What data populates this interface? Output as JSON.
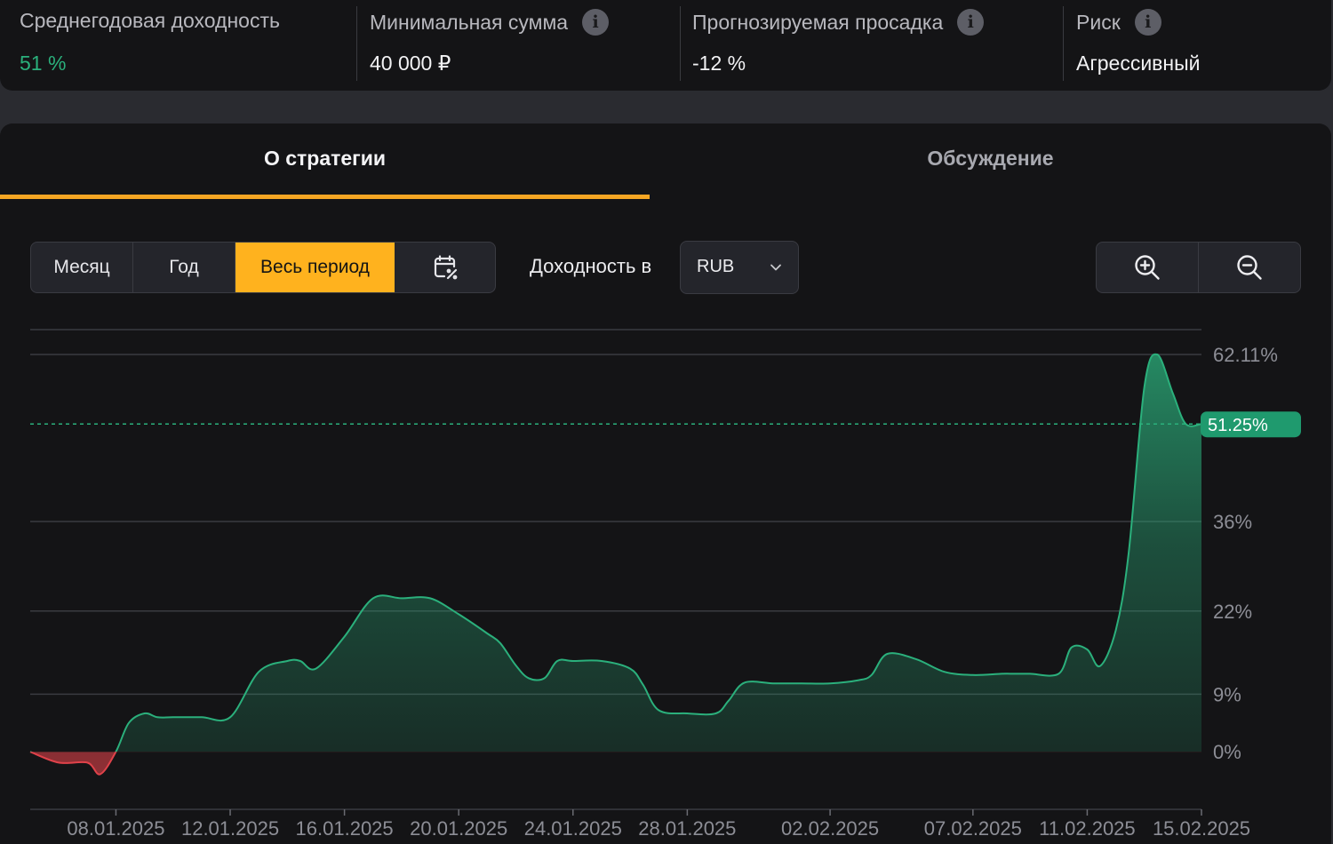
{
  "stats": [
    {
      "label": "Среднегодовая доходность",
      "value": "51 %",
      "info": false
    },
    {
      "label": "Минимальная сумма",
      "value": "40 000 ₽",
      "info": true
    },
    {
      "label": "Прогнозируемая просадка",
      "value": "-12 %",
      "info": true
    },
    {
      "label": "Риск",
      "value": "Агрессивный",
      "info": true
    }
  ],
  "tabs": [
    "О стратегии",
    "Обсуждение"
  ],
  "period": {
    "buttons": [
      "Месяц",
      "Год",
      "Весь период"
    ],
    "active": "Весь период",
    "calendar_icon": "calendar-percent-icon"
  },
  "yield_label": "Доходность в",
  "currency": {
    "selected": "RUB"
  },
  "zoom": {
    "in_icon": "zoom-in-icon",
    "out_icon": "zoom-out-icon"
  },
  "colors": {
    "accent": "#ffb21e",
    "positive": "#2bb07c",
    "negative": "#e0424a",
    "badge": "#1f9a6e"
  },
  "chart_data": {
    "type": "area",
    "ytick_labels": [
      "62.11%",
      "36%",
      "22%",
      "9%",
      "0%"
    ],
    "yticks": [
      62.11,
      36,
      22,
      9,
      0
    ],
    "ylim": [
      -9,
      66
    ],
    "xtick_labels": [
      "08.01.2025",
      "12.01.2025",
      "16.01.2025",
      "20.01.2025",
      "24.01.2025",
      "28.01.2025",
      "02.02.2025",
      "07.02.2025",
      "11.02.2025",
      "15.02.2025"
    ],
    "xticks": [
      "2025-01-08",
      "2025-01-12",
      "2025-01-16",
      "2025-01-20",
      "2025-01-24",
      "2025-01-28",
      "2025-02-02",
      "2025-02-07",
      "2025-02-11",
      "2025-02-15"
    ],
    "xlim": [
      "2025-01-05",
      "2025-02-15"
    ],
    "current_value": 51.25,
    "current_label": "51.25%",
    "baseline": 0,
    "series": [
      {
        "x": [
          "2025-01-05",
          "2025-01-06",
          "2025-01-07",
          "2025-01-07",
          "2025-01-08",
          "2025-01-08",
          "2025-01-09",
          "2025-01-09",
          "2025-01-10",
          "2025-01-11",
          "2025-01-12",
          "2025-01-13",
          "2025-01-14",
          "2025-01-14",
          "2025-01-15",
          "2025-01-16",
          "2025-01-17",
          "2025-01-18",
          "2025-01-19",
          "2025-01-20",
          "2025-01-21",
          "2025-01-21",
          "2025-01-22",
          "2025-01-22",
          "2025-01-23",
          "2025-01-23",
          "2025-01-24",
          "2025-01-25",
          "2025-01-26",
          "2025-01-26",
          "2025-01-27",
          "2025-01-28",
          "2025-01-29",
          "2025-01-29",
          "2025-01-30",
          "2025-01-31",
          "2025-02-01",
          "2025-02-02",
          "2025-02-03",
          "2025-02-03",
          "2025-02-04",
          "2025-02-05",
          "2025-02-06",
          "2025-02-07",
          "2025-02-08",
          "2025-02-08",
          "2025-02-09",
          "2025-02-10",
          "2025-02-10",
          "2025-02-11",
          "2025-02-11",
          "2025-02-12",
          "2025-02-12",
          "2025-02-13",
          "2025-02-13",
          "2025-02-14",
          "2025-02-14",
          "2025-02-15"
        ],
        "y": [
          0,
          -1.7,
          -1.7,
          -3.5,
          0,
          4.5,
          6,
          5.4,
          5.4,
          5.4,
          5.4,
          12.5,
          14.2,
          14.2,
          13,
          18,
          24,
          24,
          24,
          21.5,
          18.5,
          17,
          13.5,
          11.5,
          11.5,
          14.2,
          14.2,
          14.2,
          13,
          10.5,
          6.5,
          6,
          6,
          8,
          10.8,
          10.7,
          10.7,
          10.7,
          11.2,
          12,
          15.3,
          14.5,
          12.5,
          12,
          12.2,
          12.2,
          12.2,
          12.2,
          16.3,
          16,
          13.4,
          19,
          31,
          57,
          62.11,
          56,
          51.25,
          51.25
        ]
      }
    ]
  }
}
